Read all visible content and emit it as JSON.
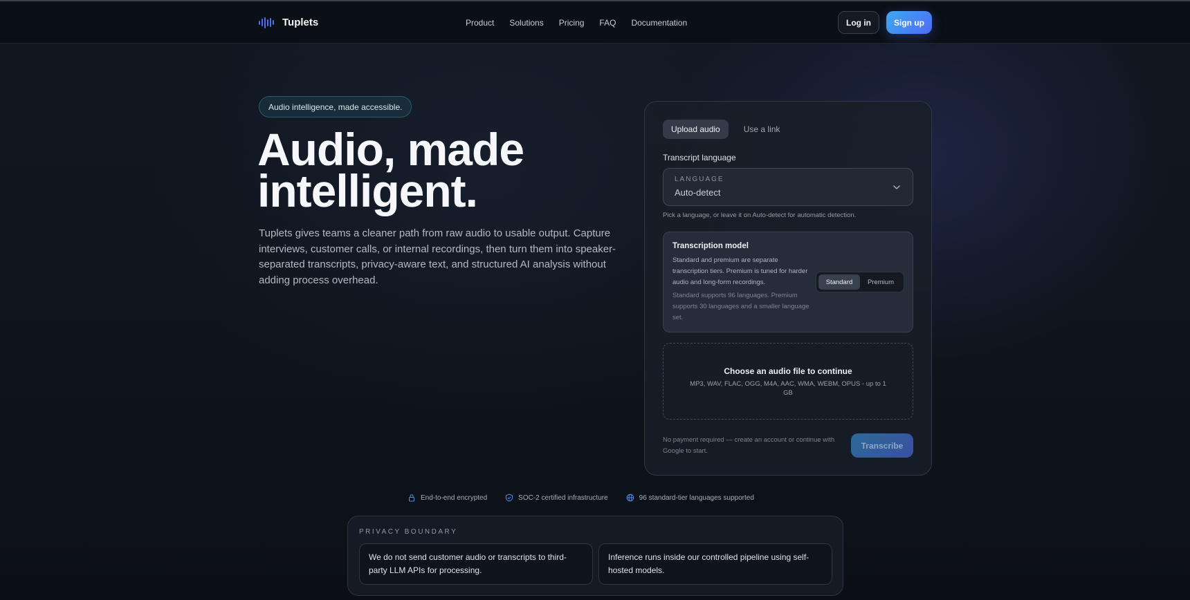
{
  "brand": {
    "name": "Tuplets",
    "logo_icon": "waveform-icon",
    "accent": "#4f6cf7"
  },
  "nav": {
    "links": [
      "Product",
      "Solutions",
      "Pricing",
      "FAQ",
      "Documentation"
    ],
    "login_label": "Log in",
    "signup_label": "Sign up"
  },
  "hero": {
    "tagline": "Audio intelligence, made accessible.",
    "title_line1": "Audio, made",
    "title_line2": "intelligent.",
    "description": "Tuplets gives teams a cleaner path from raw audio to usable output. Capture interviews, customer calls, or internal recordings, then turn them into speaker-separated transcripts, privacy-aware text, and structured AI analysis without adding process overhead."
  },
  "upload_card": {
    "tabs": [
      {
        "label": "Upload audio",
        "active": true
      },
      {
        "label": "Use a link",
        "active": false
      }
    ],
    "language_label": "Transcript language",
    "language_caption": "LANGUAGE",
    "language_value": "Auto-detect",
    "language_hint": "Pick a language, or leave it on Auto-detect for automatic detection.",
    "model": {
      "title": "Transcription model",
      "description": "Standard and premium are separate transcription tiers. Premium is tuned for harder audio and long-form recordings.",
      "note": "Standard supports 96 languages. Premium supports 30 languages and a smaller language set.",
      "options": [
        "Standard",
        "Premium"
      ],
      "selected": "Standard"
    },
    "dropzone": {
      "title": "Choose an audio file to continue",
      "formats": "MP3, WAV, FLAC, OGG, M4A, AAC, WMA, WEBM, OPUS - up to 1 GB"
    },
    "footer_note": "No payment required — create an account or continue with Google to start.",
    "transcribe_label": "Transcribe"
  },
  "trust": [
    {
      "icon": "lock-icon",
      "label": "End-to-end encrypted"
    },
    {
      "icon": "shield-icon",
      "label": "SOC-2 certified infrastructure"
    },
    {
      "icon": "globe-icon",
      "label": "96 standard-tier languages supported"
    }
  ],
  "privacy": {
    "label": "PRIVACY BOUNDARY",
    "cards": [
      "We do not send customer audio or transcripts to third-party LLM APIs for processing.",
      "Inference runs inside our controlled pipeline using self-hosted models."
    ]
  }
}
